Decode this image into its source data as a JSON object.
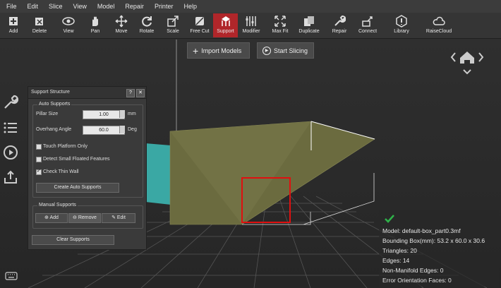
{
  "menu": [
    "File",
    "Edit",
    "Slice",
    "View",
    "Model",
    "Repair",
    "Printer",
    "Help"
  ],
  "toolbar": {
    "add": "Add",
    "delete": "Delete",
    "view": "View",
    "pan": "Pan",
    "move": "Move",
    "rotate": "Rotate",
    "scale": "Scale",
    "free_cut": "Free Cut",
    "support": "Support",
    "modifier": "Modifier",
    "max_fit": "Max Fit",
    "duplicate": "Duplicate",
    "repair": "Repair",
    "connect": "Connect",
    "library": "Library",
    "raisecloud": "RaiseCloud"
  },
  "actions": {
    "import": "Import Models",
    "slice": "Start Slicing"
  },
  "panel": {
    "title": "Support Structure",
    "help": "?",
    "auto_label": "Auto Supports",
    "pillar_label": "Pillar Size",
    "pillar_value": "1.00",
    "pillar_unit": "mm",
    "overhang_label": "Overhang Angle",
    "overhang_value": "60.0",
    "overhang_unit": "Deg",
    "platform_only": "Touch Platform Only",
    "small_floated": "Detect Small Floated Features",
    "thin_wall": "Check Thin Wall",
    "create_auto": "Create Auto Supports",
    "manual_label": "Manual Supports",
    "add": "Add",
    "remove": "Remove",
    "edit": "Edit",
    "clear": "Clear Supports"
  },
  "checkboxes": {
    "platform_only": false,
    "small_floated": false,
    "thin_wall": true
  },
  "info": {
    "model": "Model: default-box_part0.3mf",
    "bbox": "Bounding Box(mm): 53.2 x 60.0 x 30.6",
    "triangles": "Triangles: 20",
    "edges": "Edges: 14",
    "non_manifold": "Non-Manifold Edges: 0",
    "error_faces": "Error Orientation Faces: 0"
  },
  "colors": {
    "accent": "#b0262a",
    "model": "#6b6b3f",
    "cyan": "#3aa8a4",
    "highlight": "#e01010",
    "ok": "#2fb34a"
  }
}
